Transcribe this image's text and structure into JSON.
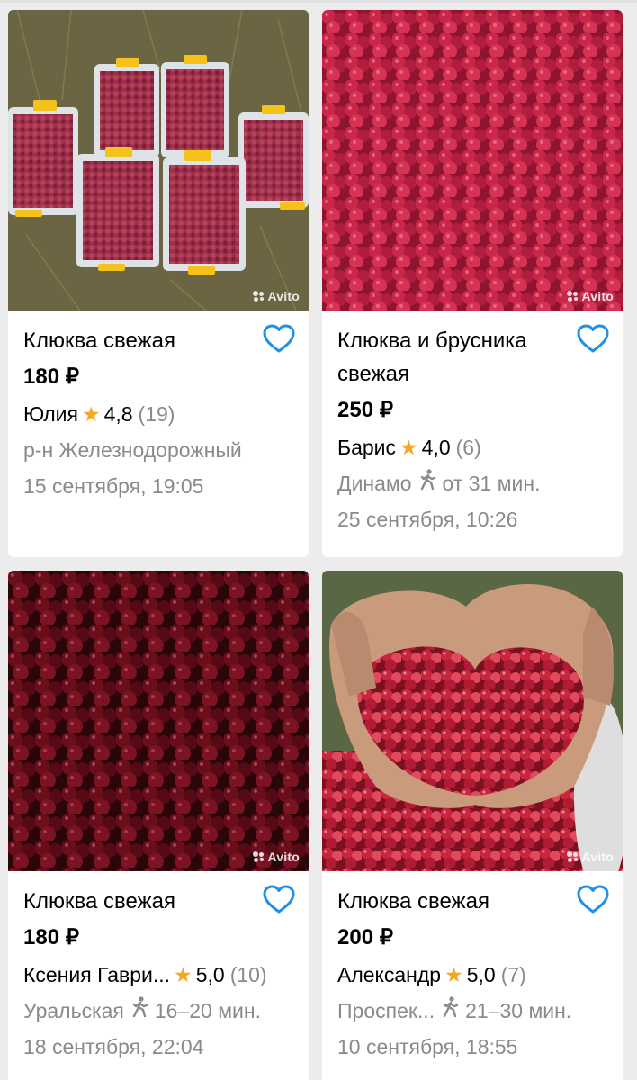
{
  "listings": [
    {
      "title": "Клюква свежая",
      "price": "180 ₽",
      "seller": "Юлия",
      "rating": "4,8",
      "reviews": "(19)",
      "location": "р-н Железнодорожный",
      "walk_time": "",
      "date": "15 сентября, 19:05",
      "photo": "cranberries-in-plastic-containers",
      "watermark": "Avito"
    },
    {
      "title": "Клюква и брусника свежая",
      "price": "250 ₽",
      "seller": "Барис",
      "rating": "4,0",
      "reviews": "(6)",
      "location": "Динамо",
      "walk_time": "от 31 мин.",
      "date": "25 сентября, 10:26",
      "photo": "red-cranberries-closeup",
      "watermark": "Avito"
    },
    {
      "title": "Клюква свежая",
      "price": "180 ₽",
      "seller": "Ксения Гаври...",
      "rating": "5,0",
      "reviews": "(10)",
      "location": "Уральская",
      "walk_time": "16–20 мин.",
      "date": "18 сентября, 22:04",
      "photo": "dark-cranberries-closeup",
      "watermark": "Avito"
    },
    {
      "title": "Клюква свежая",
      "price": "200 ₽",
      "seller": "Александр",
      "rating": "5,0",
      "reviews": "(7)",
      "location": "Проспек...",
      "walk_time": "21–30 мин.",
      "date": "10 сентября, 18:55",
      "photo": "cranberries-in-hands",
      "watermark": "Avito"
    }
  ],
  "colors": {
    "star": "#f5a623",
    "favorite_icon": "#1e90e6",
    "muted_text": "#8a8a8a",
    "background": "#ececec"
  }
}
